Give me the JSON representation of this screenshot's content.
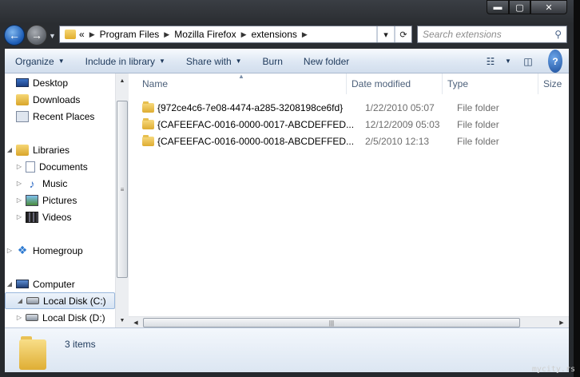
{
  "address": {
    "overflow": "«",
    "crumbs": [
      "Program Files",
      "Mozilla Firefox",
      "extensions"
    ]
  },
  "search": {
    "placeholder": "Search extensions"
  },
  "toolbar": {
    "organize": "Organize",
    "include_in_library": "Include in library",
    "share_with": "Share with",
    "burn": "Burn",
    "new_folder": "New folder"
  },
  "nav": {
    "favorites": [
      "Desktop",
      "Downloads",
      "Recent Places"
    ],
    "libraries": "Libraries",
    "library_items": [
      "Documents",
      "Music",
      "Pictures",
      "Videos"
    ],
    "homegroup": "Homegroup",
    "computer": "Computer",
    "drives": [
      "Local Disk (C:)",
      "Local Disk (D:)"
    ]
  },
  "columns": {
    "name": "Name",
    "date": "Date modified",
    "type": "Type",
    "size": "Size"
  },
  "files": [
    {
      "name": "{972ce4c6-7e08-4474-a285-3208198ce6fd}",
      "date": "1/22/2010 05:07",
      "type": "File folder"
    },
    {
      "name": "{CAFEEFAC-0016-0000-0017-ABCDEFFED...",
      "date": "12/12/2009 05:03",
      "type": "File folder"
    },
    {
      "name": "{CAFEEFAC-0016-0000-0018-ABCDEFFED...",
      "date": "2/5/2010 12:13",
      "type": "File folder"
    }
  ],
  "status": {
    "item_count": "3 items"
  },
  "watermark": "mycity.rs",
  "colors": {
    "toolbar_text": "#1e395b",
    "header_text": "#4c607a",
    "frame": "#2a2d31"
  }
}
